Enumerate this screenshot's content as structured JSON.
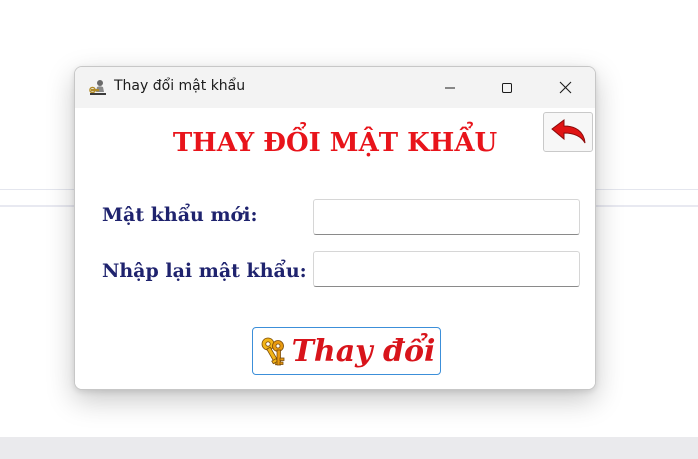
{
  "window": {
    "title": "Thay đổi mật khẩu",
    "app_icon": "key-user-icon",
    "controls": [
      "minimize-icon",
      "maximize-icon",
      "close-icon"
    ]
  },
  "form": {
    "heading": "THAY ĐỔI MẬT KHẨU",
    "heading_color": "#e8141b",
    "back_icon": "back-arrow-icon",
    "new_password_label": "Mật khẩu mới:",
    "new_password_value": "",
    "confirm_password_label": "Nhập lại mật khẩu:",
    "confirm_password_value": "",
    "label_color": "#1f236e",
    "submit_label": "Thay đổi",
    "submit_icon": "keys-icon",
    "submit_color": "#d8141b"
  }
}
